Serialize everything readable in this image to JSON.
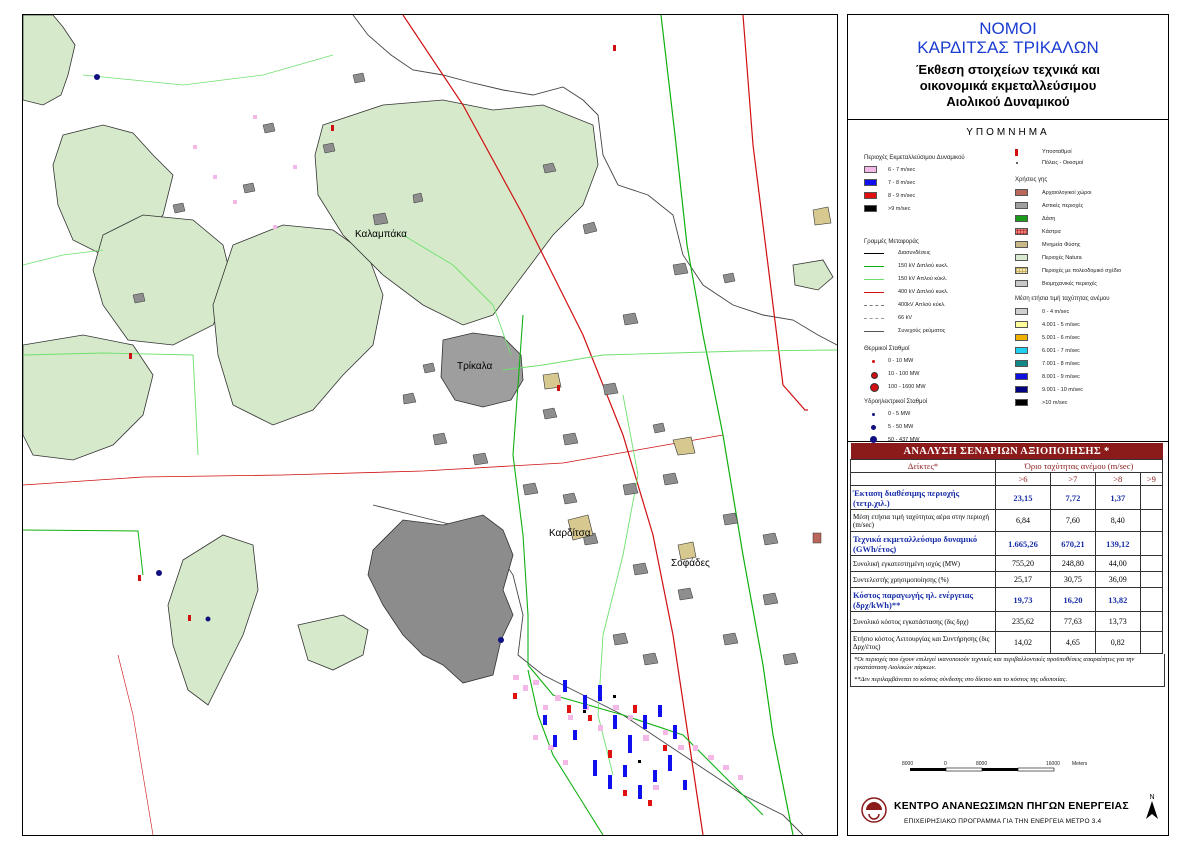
{
  "map": {
    "towns": [
      {
        "id": "kalampaka",
        "name": "Καλαμπάκα"
      },
      {
        "id": "trikala",
        "name": "Τρίκαλα"
      },
      {
        "id": "karditsa",
        "name": "Καρδίτσα"
      },
      {
        "id": "sofades",
        "name": "Σοφάδες"
      }
    ]
  },
  "title": {
    "line1": "ΝΟΜΟΙ",
    "line2": "ΚΑΡΔΙΤΣΑΣ ΤΡΙΚΑΛΩΝ",
    "subtitle_1": "Έκθεση στοιχείων τεχνικά και",
    "subtitle_2": "οικονομικά εκμεταλλεύσιμου",
    "subtitle_3": "Αιολικού Δυναμικού"
  },
  "legend": {
    "title": "ΥΠΟΜΝΗΜΑ",
    "wind_areas": {
      "heading": "Περιοχές Εκμεταλλεύσιμου Δυναμικού",
      "items": [
        {
          "label": "6 - 7 m/sec",
          "color": "#f4b8e6"
        },
        {
          "label": "7 - 8 m/sec",
          "color": "#1010ee"
        },
        {
          "label": "8 - 9 m/sec",
          "color": "#e01010"
        },
        {
          "label": ">9 m/sec",
          "color": "#000000"
        }
      ]
    },
    "lines": {
      "heading": "Γραμμές Μεταφοράς",
      "items": [
        {
          "label": "Διασυνδέσεις",
          "color": "#000000",
          "style": "solid"
        },
        {
          "label": "150 kV Διπλού κυκλ.",
          "color": "#10b010",
          "style": "solid"
        },
        {
          "label": "150 kV Απλού κύκλ.",
          "color": "#6ee06e",
          "style": "solid"
        },
        {
          "label": "400 kV Διπλού κυκλ.",
          "color": "#d01010",
          "style": "solid"
        },
        {
          "label": "400kV Απλού κύκλ.",
          "color": "#777777",
          "style": "dashed"
        },
        {
          "label": "66 kV",
          "color": "#999999",
          "style": "dashed"
        },
        {
          "label": "Συνεχούς ρεύματος",
          "color": "#555555",
          "style": "thin"
        }
      ]
    },
    "thermal": {
      "heading": "Θερμικοί Σταθμοί",
      "items": [
        {
          "label": "0 - 10 MW"
        },
        {
          "label": "10 - 100 MW"
        },
        {
          "label": "100 - 1600 MW"
        }
      ]
    },
    "hydro": {
      "heading": "Υδροηλεκτρικοί Σταθμοί",
      "items": [
        {
          "label": "0 - 5 MW"
        },
        {
          "label": "5 - 50 MW"
        },
        {
          "label": "50 - 437 MW"
        }
      ]
    },
    "misc": {
      "items": [
        {
          "label": "Υποσταθμοί"
        },
        {
          "label": "Πόλεις - Οικισμοί"
        }
      ]
    },
    "land_use": {
      "heading": "Χρήσεις γης",
      "items": [
        {
          "label": "Αρχαιολογικοί χώροι",
          "color": "#b8675a"
        },
        {
          "label": "Αστικές περιοχές",
          "color": "#a0a0a0"
        },
        {
          "label": "Δάση",
          "color": "#1a9a1a"
        },
        {
          "label": "Κάστρα",
          "color": "#e88080"
        },
        {
          "label": "Μνημεία Φύσης",
          "color": "#c8b888"
        },
        {
          "label": "Περιοχές Natura",
          "color": "#d8ebd0"
        },
        {
          "label": "Περιοχές με πολεοδομικό σχέδιο",
          "color": "#f0eac0"
        },
        {
          "label": "Βιομηχανικές περιοχές",
          "color": "#c8c8c8"
        }
      ]
    },
    "mean_wind": {
      "heading": "Μέση ετήσια τιμή ταχύτητας ανέμου",
      "items": [
        {
          "label": "0 - 4 m/sec",
          "color": "#d0d0d0"
        },
        {
          "label": "4.001 - 5 m/sec",
          "color": "#ffff99"
        },
        {
          "label": "5.001 - 6 m/sec",
          "color": "#f0b000"
        },
        {
          "label": "6.001 - 7 m/sec",
          "color": "#20d0f0"
        },
        {
          "label": "7.001 - 8 m/sec",
          "color": "#108888"
        },
        {
          "label": "8.001 - 9 m/sec",
          "color": "#1010e0"
        },
        {
          "label": "9.001 - 10 m/sec",
          "color": "#000080"
        },
        {
          "label": ">10 m/sec",
          "color": "#000000"
        }
      ]
    }
  },
  "table": {
    "title": "ΑΝΑΛΥΣΗ ΣΕΝΑΡΙΩΝ ΑΞΙΟΠΟΙΗΣΗΣ *",
    "col_indicators": "Δείκτες*",
    "col_threshold": "Όριο ταχύτητας ανέμου (m/sec)",
    "thresholds": [
      ">6",
      ">7",
      ">8",
      ">9"
    ],
    "rows": [
      {
        "label": "Έκταση διαθέσιμης περιοχής (τετρ.χιλ.)",
        "values": [
          "23,15",
          "7,72",
          "1,37",
          ""
        ],
        "bold": true
      },
      {
        "label": "Μέση ετήσια τιμή ταχύτητας αέρα στην περιοχή (m/sec)",
        "values": [
          "6,84",
          "7,60",
          "8,40",
          ""
        ],
        "bold": false
      },
      {
        "label": "Τεχνικά εκμεταλλεύσιμο δυναμικό (GWh/έτος)",
        "values": [
          "1.665,26",
          "670,21",
          "139,12",
          ""
        ],
        "bold": true
      },
      {
        "label": "Συνολική εγκατεστημένη ισχύς (MW)",
        "values": [
          "755,20",
          "248,80",
          "44,00",
          ""
        ],
        "bold": false
      },
      {
        "label": "Συντελεστής χρησιμοποίησης (%)",
        "values": [
          "25,17",
          "30,75",
          "36,09",
          ""
        ],
        "bold": false
      },
      {
        "label": "Κόστος παραγωγής ηλ. ενέργειας (δρχ/kWh)**",
        "values": [
          "19,73",
          "16,20",
          "13,82",
          ""
        ],
        "bold": true
      },
      {
        "label": "Συνολικό κόστος εγκατάστασης (δις δρχ)",
        "values": [
          "235,62",
          "77,63",
          "13,73",
          ""
        ],
        "bold": false
      },
      {
        "label": "Ετήσιο κόστος Λειτουργίας και Συντήρησης (δις Δρχ/έτος)",
        "values": [
          "14,02",
          "4,65",
          "0,82",
          ""
        ],
        "bold": false
      }
    ],
    "note1": "*Οι περιοχές που έχουν επιλεγεί ικανοποιούν τεχνικές και περιβαλλοντικές προϋποθέσεις απαραίτητες για την εγκατάσταση Αιολικών πάρκων.",
    "note2": "**Δεν περιλαμβάνεται το κόστος σύνδεσης στο δίκτυο και το κόστος της οδοποιίας."
  },
  "scale": {
    "labels": [
      "8000",
      "0",
      "8000",
      "16000"
    ],
    "unit": "Meters"
  },
  "footer": {
    "org": "ΚΕΝΤΡΟ ΑΝΑΝΕΩΣΙΜΩΝ ΠΗΓΩΝ ΕΝΕΡΓΕΙΑΣ",
    "program": "ΕΠΙΧΕΙΡΗΣΙΑΚΟ ΠΡΟΓΡΑΜΜΑ ΓΙΑ ΤΗΝ ΕΝΕΡΓΕΙΑ ΜΕΤΡΟ 3.4",
    "north": "N"
  }
}
